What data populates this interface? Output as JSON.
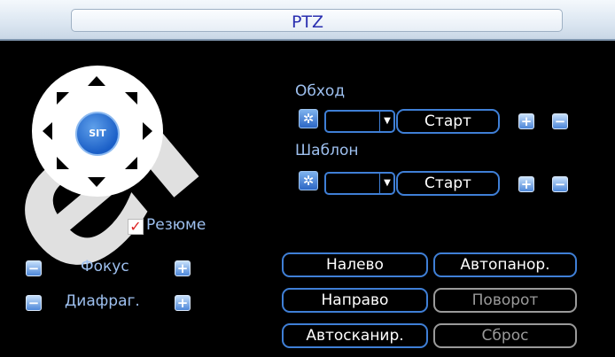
{
  "window": {
    "title": "PTZ"
  },
  "dpad": {
    "center_label": "SIT"
  },
  "tour": {
    "label": "Обход",
    "start_label": "Старт",
    "gear_icon": "gear-icon",
    "select_value": ""
  },
  "pattern": {
    "label": "Шаблон",
    "start_label": "Старт",
    "gear_icon": "gear-icon",
    "select_value": ""
  },
  "resume": {
    "label": "Резюме",
    "checked": true
  },
  "focus": {
    "label": "Фокус"
  },
  "iris": {
    "label": "Диафраг."
  },
  "buttons": {
    "left": "Налево",
    "right": "Направо",
    "autoscan": "Автосканир.",
    "autopan": "Автопанор.",
    "rotate": "Поворот",
    "reset": "Сброс"
  },
  "colors": {
    "accent": "#3f7fd6",
    "label": "#9ec0ef",
    "disabled": "#9a9a9a",
    "title": "#2a2fb0"
  }
}
